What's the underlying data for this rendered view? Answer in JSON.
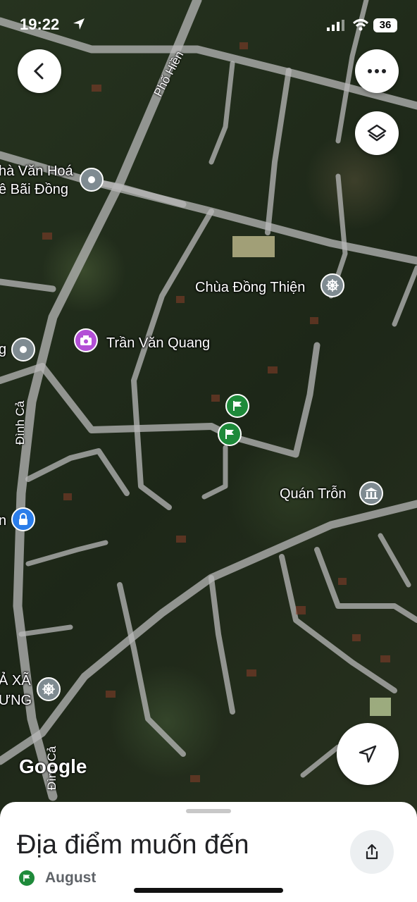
{
  "status_bar": {
    "time": "19:22",
    "battery": "36"
  },
  "map": {
    "places": [
      {
        "name": "Chùa Đồng Thiện",
        "icon": "dharma-wheel-icon"
      },
      {
        "name": "Trần Văn Quang",
        "icon": "photo-camera-icon"
      },
      {
        "name": "Quán Trỗn",
        "icon": "museum-icon"
      }
    ],
    "partial_labels": {
      "culture_house_1": "hà Văn Hoá",
      "culture_house_2": "ê Bãi Đồng",
      "left_g": "g",
      "left_n": "n",
      "temple_1": "Ả XÃ",
      "temple_2": "ƯNG"
    },
    "roads": {
      "pho_hien": "Phố Hiền",
      "dinh_ca_1": "Đình Cả",
      "dinh_ca_2": "Đình Cả"
    },
    "attribution": "Google"
  },
  "sheet": {
    "title": "Địa điểm muốn đến",
    "list_name": "August"
  },
  "colors": {
    "flag_green": "#1e8a3a",
    "pin_purple": "#b34fd6",
    "pin_blue": "#2b7de9"
  }
}
